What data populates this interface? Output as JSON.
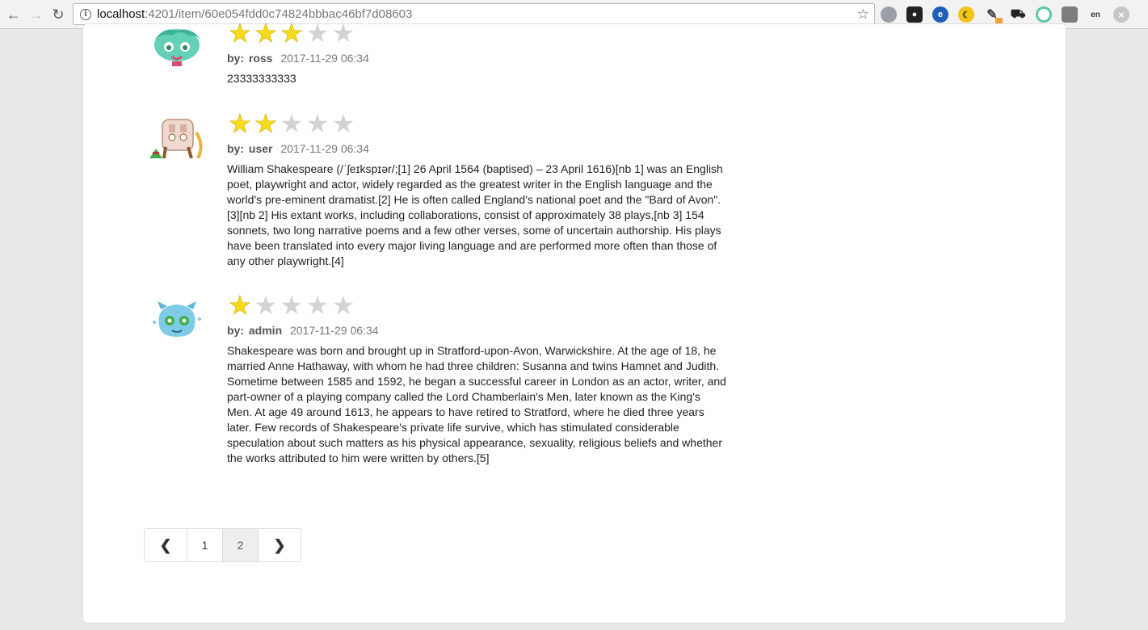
{
  "browser": {
    "back_icon": "arrow-left-icon",
    "forward_icon": "arrow-right-icon",
    "reload_icon": "reload-icon",
    "url_host": "localhost",
    "url_rest": ":4201/item/60e054fdd0c74824bbbac46bf7d08603",
    "bookmark_icon": "star-outline-icon"
  },
  "comments": [
    {
      "rating": 3,
      "max_rating": 5,
      "by_label": "by:",
      "author": "ross",
      "date": "2017-11-29 06:34",
      "text": "23333333333",
      "avatar_colors": {
        "primary": "#63d1b5",
        "secondary": "#d94a6c"
      }
    },
    {
      "rating": 2,
      "max_rating": 5,
      "by_label": "by:",
      "author": "user",
      "date": "2017-11-29 06:34",
      "text": "William Shakespeare (/ˈʃeɪkspɪər/;[1] 26 April 1564 (baptised) – 23 April 1616)[nb 1] was an English poet, playwright and actor, widely regarded as the greatest writer in the English language and the world's pre-eminent dramatist.[2] He is often called England's national poet and the \"Bard of Avon\".[3][nb 2] His extant works, including collaborations, consist of approximately 38 plays,[nb 3] 154 sonnets, two long narrative poems and a few other verses, some of uncertain authorship. His plays have been translated into every major living language and are performed more often than those of any other playwright.[4]",
      "avatar_colors": {
        "primary": "#f0d9cf",
        "secondary": "#8b5a2b"
      }
    },
    {
      "rating": 1,
      "max_rating": 5,
      "by_label": "by:",
      "author": "admin",
      "date": "2017-11-29 06:34",
      "text": "Shakespeare was born and brought up in Stratford-upon-Avon, Warwickshire. At the age of 18, he married Anne Hathaway, with whom he had three children: Susanna and twins Hamnet and Judith. Sometime between 1585 and 1592, he began a successful career in London as an actor, writer, and part-owner of a playing company called the Lord Chamberlain's Men, later known as the King's Men. At age 49 around 1613, he appears to have retired to Stratford, where he died three years later. Few records of Shakespeare's private life survive, which has stimulated considerable speculation about such matters as his physical appearance, sexuality, religious beliefs and whether the works attributed to him were written by others.[5]",
      "avatar_colors": {
        "primary": "#7fcbe6",
        "secondary": "#3fae4a"
      }
    }
  ],
  "pagination": {
    "prev_icon": "chevron-left-icon",
    "next_icon": "chevron-right-icon",
    "pages": [
      "1",
      "2"
    ],
    "current": "2"
  },
  "colors": {
    "star_on": "#f6dc18",
    "star_off": "#d3d3d3"
  }
}
